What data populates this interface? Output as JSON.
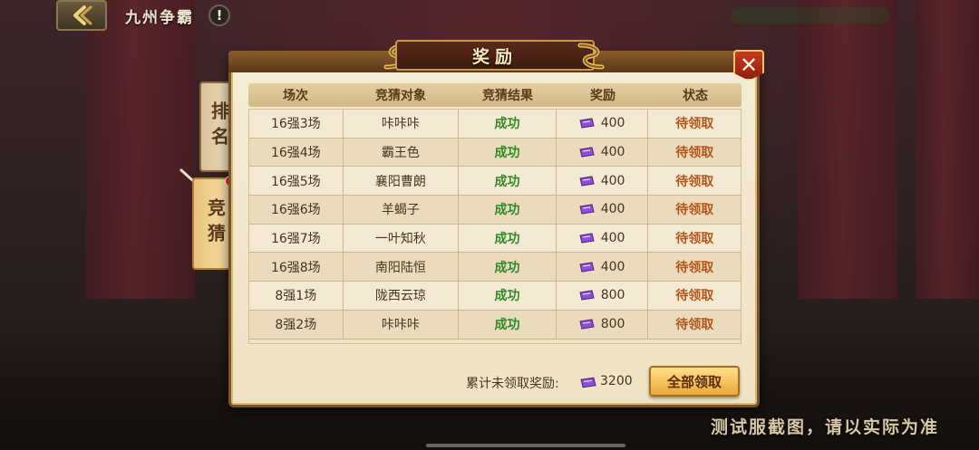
{
  "top": {
    "title": "九州争霸",
    "info": "!"
  },
  "side_tabs": {
    "rank": "排名",
    "guess": "竞猜"
  },
  "panel": {
    "title": "奖励",
    "close": "✕"
  },
  "table": {
    "headers": [
      "场次",
      "竞猜对象",
      "竞猜结果",
      "奖励",
      "状态"
    ],
    "rows": [
      {
        "match": "16强3场",
        "target": "咔咔咔",
        "result": "成功",
        "reward": "400",
        "status": "待领取"
      },
      {
        "match": "16强4场",
        "target": "霸王色",
        "result": "成功",
        "reward": "400",
        "status": "待领取"
      },
      {
        "match": "16强5场",
        "target": "襄阳曹朗",
        "result": "成功",
        "reward": "400",
        "status": "待领取"
      },
      {
        "match": "16强6场",
        "target": "羊蝎子",
        "result": "成功",
        "reward": "400",
        "status": "待领取"
      },
      {
        "match": "16强7场",
        "target": "一叶知秋",
        "result": "成功",
        "reward": "400",
        "status": "待领取"
      },
      {
        "match": "16强8场",
        "target": "南阳陆恒",
        "result": "成功",
        "reward": "400",
        "status": "待领取"
      },
      {
        "match": "8强1场",
        "target": "陇西云琼",
        "result": "成功",
        "reward": "800",
        "status": "待领取"
      },
      {
        "match": "8强2场",
        "target": "咔咔咔",
        "result": "成功",
        "reward": "800",
        "status": "待领取"
      }
    ]
  },
  "footer": {
    "label": "累计未领取奖励:",
    "total": "3200",
    "claim_all": "全部领取"
  },
  "watermark": "测试服截图，请以实际为准",
  "colors": {
    "result": "#2e8a2a",
    "status": "#b2561a",
    "gem": "#8e4fd8"
  },
  "icons": {
    "reward": "purple-gem-icon"
  }
}
